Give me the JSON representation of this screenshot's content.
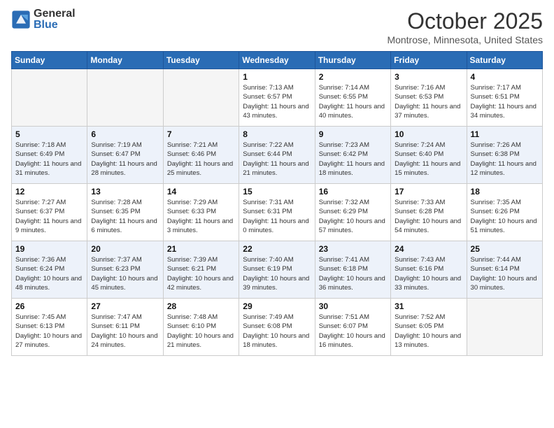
{
  "header": {
    "logo_general": "General",
    "logo_blue": "Blue",
    "month": "October 2025",
    "location": "Montrose, Minnesota, United States"
  },
  "days_of_week": [
    "Sunday",
    "Monday",
    "Tuesday",
    "Wednesday",
    "Thursday",
    "Friday",
    "Saturday"
  ],
  "weeks": [
    [
      {
        "day": "",
        "empty": true
      },
      {
        "day": "",
        "empty": true
      },
      {
        "day": "",
        "empty": true
      },
      {
        "day": "1",
        "sunrise": "7:13 AM",
        "sunset": "6:57 PM",
        "daylight": "11 hours and 43 minutes."
      },
      {
        "day": "2",
        "sunrise": "7:14 AM",
        "sunset": "6:55 PM",
        "daylight": "11 hours and 40 minutes."
      },
      {
        "day": "3",
        "sunrise": "7:16 AM",
        "sunset": "6:53 PM",
        "daylight": "11 hours and 37 minutes."
      },
      {
        "day": "4",
        "sunrise": "7:17 AM",
        "sunset": "6:51 PM",
        "daylight": "11 hours and 34 minutes."
      }
    ],
    [
      {
        "day": "5",
        "sunrise": "7:18 AM",
        "sunset": "6:49 PM",
        "daylight": "11 hours and 31 minutes."
      },
      {
        "day": "6",
        "sunrise": "7:19 AM",
        "sunset": "6:47 PM",
        "daylight": "11 hours and 28 minutes."
      },
      {
        "day": "7",
        "sunrise": "7:21 AM",
        "sunset": "6:46 PM",
        "daylight": "11 hours and 25 minutes."
      },
      {
        "day": "8",
        "sunrise": "7:22 AM",
        "sunset": "6:44 PM",
        "daylight": "11 hours and 21 minutes."
      },
      {
        "day": "9",
        "sunrise": "7:23 AM",
        "sunset": "6:42 PM",
        "daylight": "11 hours and 18 minutes."
      },
      {
        "day": "10",
        "sunrise": "7:24 AM",
        "sunset": "6:40 PM",
        "daylight": "11 hours and 15 minutes."
      },
      {
        "day": "11",
        "sunrise": "7:26 AM",
        "sunset": "6:38 PM",
        "daylight": "11 hours and 12 minutes."
      }
    ],
    [
      {
        "day": "12",
        "sunrise": "7:27 AM",
        "sunset": "6:37 PM",
        "daylight": "11 hours and 9 minutes."
      },
      {
        "day": "13",
        "sunrise": "7:28 AM",
        "sunset": "6:35 PM",
        "daylight": "11 hours and 6 minutes."
      },
      {
        "day": "14",
        "sunrise": "7:29 AM",
        "sunset": "6:33 PM",
        "daylight": "11 hours and 3 minutes."
      },
      {
        "day": "15",
        "sunrise": "7:31 AM",
        "sunset": "6:31 PM",
        "daylight": "11 hours and 0 minutes."
      },
      {
        "day": "16",
        "sunrise": "7:32 AM",
        "sunset": "6:29 PM",
        "daylight": "10 hours and 57 minutes."
      },
      {
        "day": "17",
        "sunrise": "7:33 AM",
        "sunset": "6:28 PM",
        "daylight": "10 hours and 54 minutes."
      },
      {
        "day": "18",
        "sunrise": "7:35 AM",
        "sunset": "6:26 PM",
        "daylight": "10 hours and 51 minutes."
      }
    ],
    [
      {
        "day": "19",
        "sunrise": "7:36 AM",
        "sunset": "6:24 PM",
        "daylight": "10 hours and 48 minutes."
      },
      {
        "day": "20",
        "sunrise": "7:37 AM",
        "sunset": "6:23 PM",
        "daylight": "10 hours and 45 minutes."
      },
      {
        "day": "21",
        "sunrise": "7:39 AM",
        "sunset": "6:21 PM",
        "daylight": "10 hours and 42 minutes."
      },
      {
        "day": "22",
        "sunrise": "7:40 AM",
        "sunset": "6:19 PM",
        "daylight": "10 hours and 39 minutes."
      },
      {
        "day": "23",
        "sunrise": "7:41 AM",
        "sunset": "6:18 PM",
        "daylight": "10 hours and 36 minutes."
      },
      {
        "day": "24",
        "sunrise": "7:43 AM",
        "sunset": "6:16 PM",
        "daylight": "10 hours and 33 minutes."
      },
      {
        "day": "25",
        "sunrise": "7:44 AM",
        "sunset": "6:14 PM",
        "daylight": "10 hours and 30 minutes."
      }
    ],
    [
      {
        "day": "26",
        "sunrise": "7:45 AM",
        "sunset": "6:13 PM",
        "daylight": "10 hours and 27 minutes."
      },
      {
        "day": "27",
        "sunrise": "7:47 AM",
        "sunset": "6:11 PM",
        "daylight": "10 hours and 24 minutes."
      },
      {
        "day": "28",
        "sunrise": "7:48 AM",
        "sunset": "6:10 PM",
        "daylight": "10 hours and 21 minutes."
      },
      {
        "day": "29",
        "sunrise": "7:49 AM",
        "sunset": "6:08 PM",
        "daylight": "10 hours and 18 minutes."
      },
      {
        "day": "30",
        "sunrise": "7:51 AM",
        "sunset": "6:07 PM",
        "daylight": "10 hours and 16 minutes."
      },
      {
        "day": "31",
        "sunrise": "7:52 AM",
        "sunset": "6:05 PM",
        "daylight": "10 hours and 13 minutes."
      },
      {
        "day": "",
        "empty": true
      }
    ]
  ]
}
